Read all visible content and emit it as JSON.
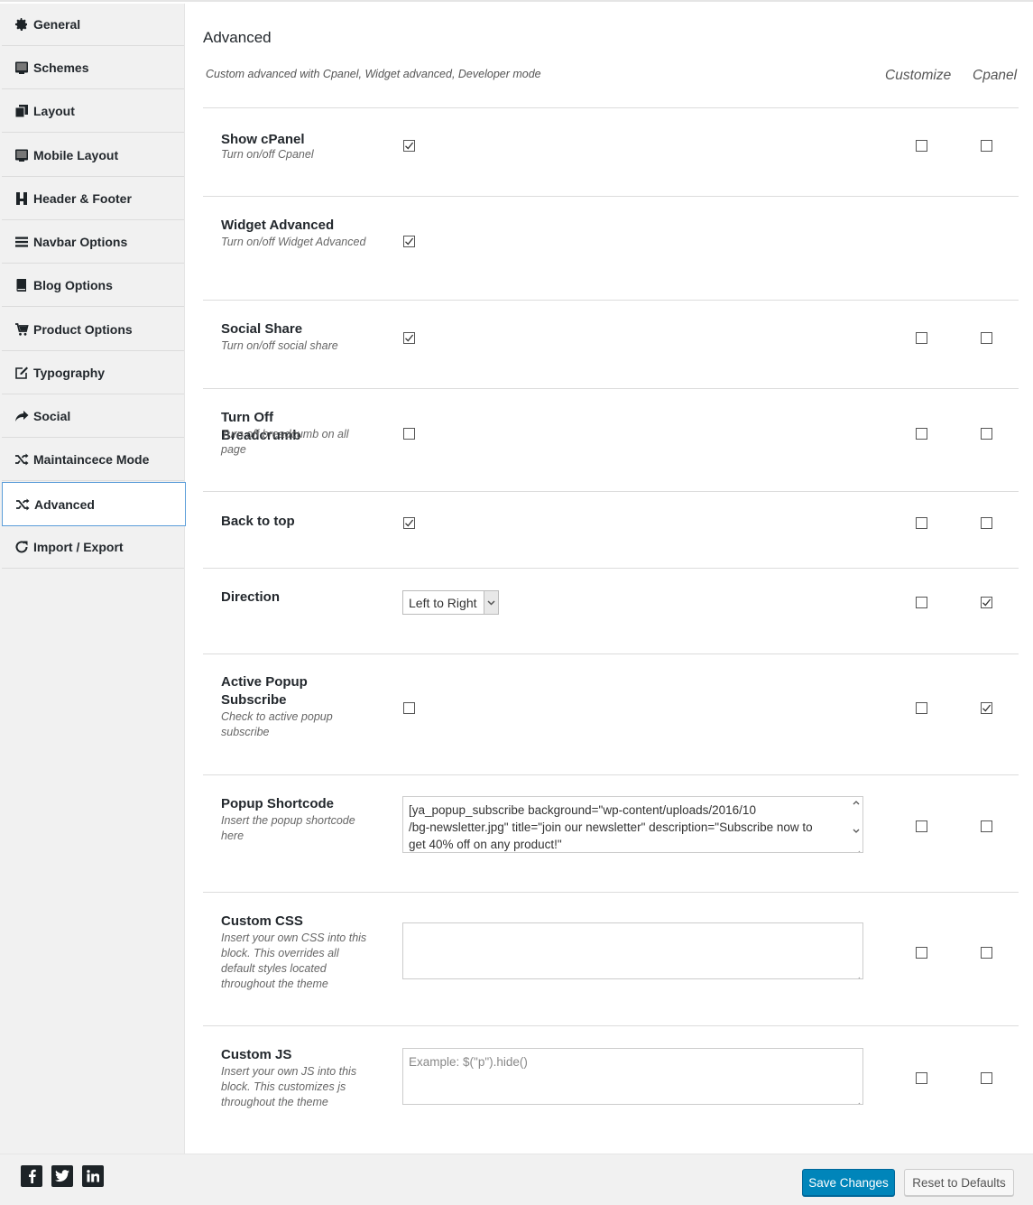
{
  "sidebar": {
    "items": [
      {
        "label": "General",
        "icon": "gear-icon"
      },
      {
        "label": "Schemes",
        "icon": "monitor-icon"
      },
      {
        "label": "Layout",
        "icon": "copy-icon"
      },
      {
        "label": "Mobile Layout",
        "icon": "monitor-icon"
      },
      {
        "label": "Header & Footer",
        "icon": "header-icon"
      },
      {
        "label": "Navbar Options",
        "icon": "bars-icon"
      },
      {
        "label": "Blog Options",
        "icon": "book-icon"
      },
      {
        "label": "Product Options",
        "icon": "cart-icon"
      },
      {
        "label": "Typography",
        "icon": "edit-icon"
      },
      {
        "label": "Social",
        "icon": "share-icon"
      },
      {
        "label": "Maintaincece Mode",
        "icon": "shuffle-icon"
      },
      {
        "label": "Advanced",
        "icon": "shuffle-icon",
        "active": true
      },
      {
        "label": "Import / Export",
        "icon": "refresh-icon"
      }
    ]
  },
  "main": {
    "title": "Advanced",
    "description": "Custom advanced with Cpanel, Widget advanced, Developer mode",
    "columns": {
      "customize": "Customize",
      "cpanel": "Cpanel"
    },
    "rows": [
      {
        "title": "Show cPanel",
        "desc": "Turn on/off Cpanel",
        "value": true,
        "customize": false,
        "cpanel": false
      },
      {
        "title": "Widget Advanced",
        "desc": "Turn on/off Widget Advanced",
        "value": true
      },
      {
        "title": "Social Share",
        "desc": "Turn on/off social share",
        "value": true,
        "customize": false,
        "cpanel": false
      },
      {
        "title": "Turn Off Breadcrumb",
        "desc": "Turn off breadcumb on all page",
        "value": false,
        "customize": false,
        "cpanel": false
      },
      {
        "title": "Back to top",
        "desc": "",
        "value": true,
        "customize": false,
        "cpanel": false
      },
      {
        "title": "Direction",
        "desc": "",
        "select_value": "Left to Right",
        "customize": false,
        "cpanel": true
      },
      {
        "title": "Active Popup Subscribe",
        "desc": "Check to active popup subscribe",
        "value": false,
        "customize": false,
        "cpanel": true
      },
      {
        "title": "Popup Shortcode",
        "desc": "Insert the popup shortcode here",
        "text_value": "[ya_popup_subscribe background=\"wp-content/uploads/2016/10\n/bg-newsletter.jpg\" title=\"join our newsletter\" description=\"Subscribe now to\nget 40% off on any product!\"",
        "customize": false,
        "cpanel": false
      },
      {
        "title": "Custom CSS",
        "desc": "Insert your own CSS into this block. This overrides all default styles located throughout the theme",
        "text_value": "",
        "customize": false,
        "cpanel": false
      },
      {
        "title": "Custom JS",
        "desc": "Insert your own JS into this block. This customizes js throughout the theme",
        "placeholder": "Example: $(\"p\").hide()",
        "customize": false,
        "cpanel": false
      }
    ]
  },
  "footer": {
    "social": [
      "facebook-icon",
      "twitter-icon",
      "linkedin-icon"
    ],
    "save_label": "Save Changes",
    "reset_label": "Reset to Defaults"
  },
  "colors": {
    "primary": "#0085ba",
    "active_border": "#5b9dd9"
  }
}
